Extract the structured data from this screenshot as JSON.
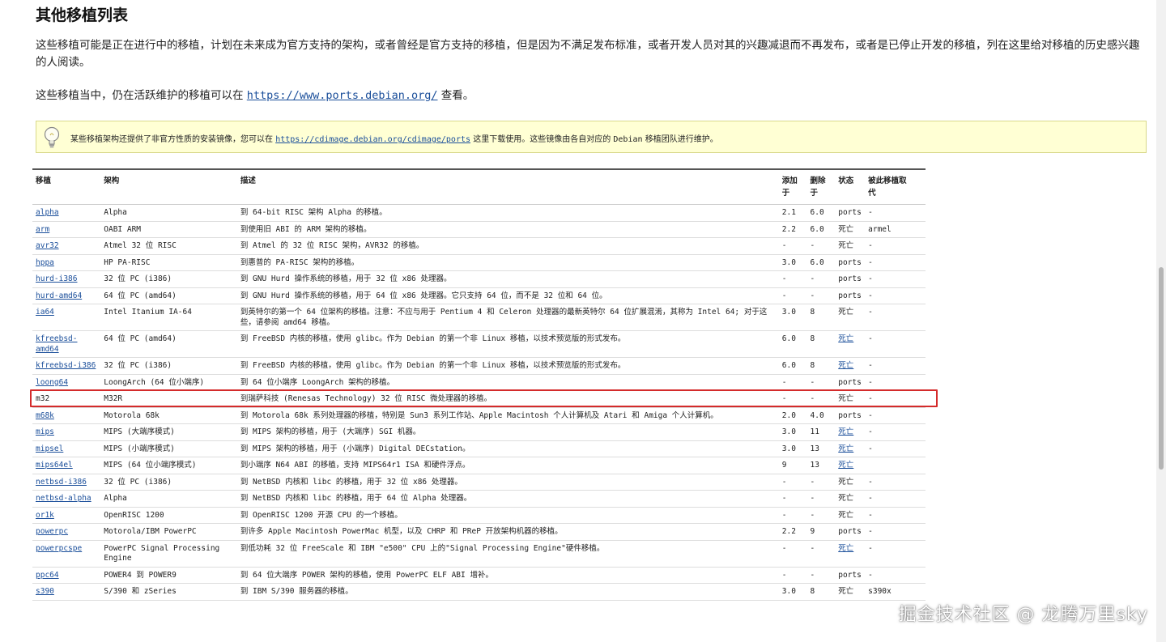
{
  "heading": "其他移植列表",
  "intro": "这些移植可能是正在进行中的移植，计划在未来成为官方支持的架构，或者曾经是官方支持的移植，但是因为不满足发布标准，或者开发人员对其的兴趣减退而不再发布，或者是已停止开发的移植，列在这里给对移植的历史感兴趣的人阅读。",
  "active": {
    "prefix": "这些移植当中，仍在活跃维护的移植可以在",
    "link": "https://www.ports.debian.org/",
    "suffix": "查看。"
  },
  "tip": {
    "icon": "lightbulb-icon",
    "prefix": "某些移植架构还提供了非官方性质的安装镜像，您可以在",
    "link": "https://cdimage.debian.org/cdimage/ports",
    "middle": "这里下载使用。这些镜像由各自对应的",
    "debian": "Debian",
    "suffix": "移植团队进行维护。",
    "bg_color": "#ffffd4"
  },
  "table": {
    "headers": {
      "port": "移植",
      "arch": "架构",
      "desc": "描述",
      "added_l1": "添加",
      "added_l2": "于",
      "removed_l1": "删除",
      "removed_l2": "于",
      "status": "状态",
      "replaced_l1": "被此移植取",
      "replaced_l2": "代"
    },
    "rows": [
      {
        "port": "alpha",
        "link": true,
        "arch": "Alpha",
        "desc": "到 64-bit RISC 架构 Alpha 的移植。",
        "added": "2.1",
        "removed": "6.0",
        "status": "ports",
        "status_link": false,
        "replaced": "-"
      },
      {
        "port": "arm",
        "link": true,
        "arch": "OABI ARM",
        "desc": "到使用旧 ABI 的 ARM 架构的移植。",
        "added": "2.2",
        "removed": "6.0",
        "status": "死亡",
        "status_link": false,
        "replaced": "armel"
      },
      {
        "port": "avr32",
        "link": true,
        "arch": "Atmel 32 位 RISC",
        "desc": "到 Atmel 的 32 位 RISC 架构，AVR32 的移植。",
        "added": "-",
        "removed": "-",
        "status": "死亡",
        "status_link": false,
        "replaced": "-"
      },
      {
        "port": "hppa",
        "link": true,
        "arch": "HP PA-RISC",
        "desc": "到惠普的 PA-RISC 架构的移植。",
        "added": "3.0",
        "removed": "6.0",
        "status": "ports",
        "status_link": false,
        "replaced": "-"
      },
      {
        "port": "hurd-i386",
        "link": true,
        "arch": "32 位 PC (i386)",
        "desc": "到 GNU Hurd 操作系统的移植，用于 32 位 x86 处理器。",
        "added": "-",
        "removed": "-",
        "status": "ports",
        "status_link": false,
        "replaced": "-"
      },
      {
        "port": "hurd-amd64",
        "link": true,
        "arch": "64 位 PC (amd64)",
        "desc": "到 GNU Hurd 操作系统的移植，用于 64 位 x86 处理器。它只支持 64 位，而不是 32 位和 64 位。",
        "added": "-",
        "removed": "-",
        "status": "ports",
        "status_link": false,
        "replaced": "-"
      },
      {
        "port": "ia64",
        "link": true,
        "arch": "Intel Itanium IA-64",
        "desc": "到英特尔的第一个 64 位架构的移植。注意：不应与用于 Pentium 4 和 Celeron 处理器的最新英特尔 64 位扩展混淆，其称为 Intel 64; 对于这些，请参阅 amd64 移植。",
        "added": "3.0",
        "removed": "8",
        "status": "死亡",
        "status_link": false,
        "replaced": "-"
      },
      {
        "port": "kfreebsd-amd64",
        "link": true,
        "arch": "64 位 PC (amd64)",
        "desc": "到 FreeBSD 内核的移植，使用 glibc。作为 Debian 的第一个非 Linux 移植，以技术预览版的形式发布。",
        "added": "6.0",
        "removed": "8",
        "status": "死亡",
        "status_link": true,
        "replaced": "-"
      },
      {
        "port": "kfreebsd-i386",
        "link": true,
        "arch": "32 位 PC (i386)",
        "desc": "到 FreeBSD 内核的移植，使用 glibc。作为 Debian 的第一个非 Linux 移植，以技术预览版的形式发布。",
        "added": "6.0",
        "removed": "8",
        "status": "死亡",
        "status_link": true,
        "replaced": "-"
      },
      {
        "port": "loong64",
        "link": true,
        "arch": "LoongArch (64 位小端序)",
        "desc": "到 64 位小端序 LoongArch 架构的移植。",
        "added": "-",
        "removed": "-",
        "status": "ports",
        "status_link": false,
        "replaced": "-"
      },
      {
        "port": "m32",
        "link": false,
        "arch": "M32R",
        "desc": "到瑞萨科技 (Renesas Technology) 32 位 RISC 微处理器的移植。",
        "added": "-",
        "removed": "-",
        "status": "死亡",
        "status_link": false,
        "replaced": "-"
      },
      {
        "port": "m68k",
        "link": true,
        "arch": "Motorola 68k",
        "desc": "到 Motorola 68k 系列处理器的移植，特别是 Sun3 系列工作站、Apple Macintosh 个人计算机及 Atari 和 Amiga 个人计算机。",
        "added": "2.0",
        "removed": "4.0",
        "status": "ports",
        "status_link": false,
        "replaced": "-"
      },
      {
        "port": "mips",
        "link": true,
        "arch": "MIPS (大端序模式)",
        "desc": "到 MIPS 架构的移植，用于 (大端序) SGI 机器。",
        "added": "3.0",
        "removed": "11",
        "status": "死亡",
        "status_link": true,
        "replaced": "-"
      },
      {
        "port": "mipsel",
        "link": true,
        "arch": "MIPS (小端序模式)",
        "desc": "到 MIPS 架构的移植，用于 (小端序) Digital DECstation。",
        "added": "3.0",
        "removed": "13",
        "status": "死亡",
        "status_link": true,
        "replaced": "-"
      },
      {
        "port": "mips64el",
        "link": true,
        "arch": "MIPS (64 位小端序模式)",
        "desc": "到小端序 N64 ABI 的移植，支持 MIPS64r1 ISA 和硬件浮点。",
        "added": "9",
        "removed": "13",
        "status": "死亡",
        "status_link": true,
        "replaced": ""
      },
      {
        "port": "netbsd-i386",
        "link": true,
        "arch": "32 位 PC (i386)",
        "desc": "到 NetBSD 内核和 libc 的移植，用于 32 位 x86 处理器。",
        "added": "-",
        "removed": "-",
        "status": "死亡",
        "status_link": false,
        "replaced": "-"
      },
      {
        "port": "netbsd-alpha",
        "link": true,
        "arch": "Alpha",
        "desc": "到 NetBSD 内核和 libc 的移植，用于 64 位 Alpha 处理器。",
        "added": "-",
        "removed": "-",
        "status": "死亡",
        "status_link": false,
        "replaced": "-"
      },
      {
        "port": "or1k",
        "link": true,
        "arch": "OpenRISC 1200",
        "desc": "到 OpenRISC 1200 开源 CPU 的一个移植。",
        "added": "-",
        "removed": "-",
        "status": "死亡",
        "status_link": false,
        "replaced": "-"
      },
      {
        "port": "powerpc",
        "link": true,
        "arch": "Motorola/IBM PowerPC",
        "desc": "到许多 Apple Macintosh PowerMac 机型，以及 CHRP 和 PReP 开放架构机器的移植。",
        "added": "2.2",
        "removed": "9",
        "status": "ports",
        "status_link": false,
        "replaced": "-"
      },
      {
        "port": "powerpcspe",
        "link": true,
        "arch": "PowerPC Signal Processing Engine",
        "desc": "到低功耗 32 位 FreeScale 和 IBM \"e500\" CPU 上的\"Signal Processing Engine\"硬件移植。",
        "added": "-",
        "removed": "-",
        "status": "死亡",
        "status_link": true,
        "replaced": "-"
      },
      {
        "port": "ppc64",
        "link": true,
        "arch": "POWER4 到 POWER9",
        "desc": "到 64 位大端序 POWER 架构的移植，使用 PowerPC ELF ABI 增补。",
        "added": "-",
        "removed": "-",
        "status": "ports",
        "status_link": false,
        "replaced": "-"
      },
      {
        "port": "s390",
        "link": true,
        "arch": "S/390 和 zSeries",
        "desc": "到 IBM S/390 服务器的移植。",
        "added": "3.0",
        "removed": "8",
        "status": "死亡",
        "status_link": false,
        "replaced": "s390x"
      }
    ]
  },
  "watermark": "掘金技术社区 @ 龙腾万里sky",
  "colors": {
    "link": "#1a4e9a",
    "highlight": "#d42b2b"
  }
}
